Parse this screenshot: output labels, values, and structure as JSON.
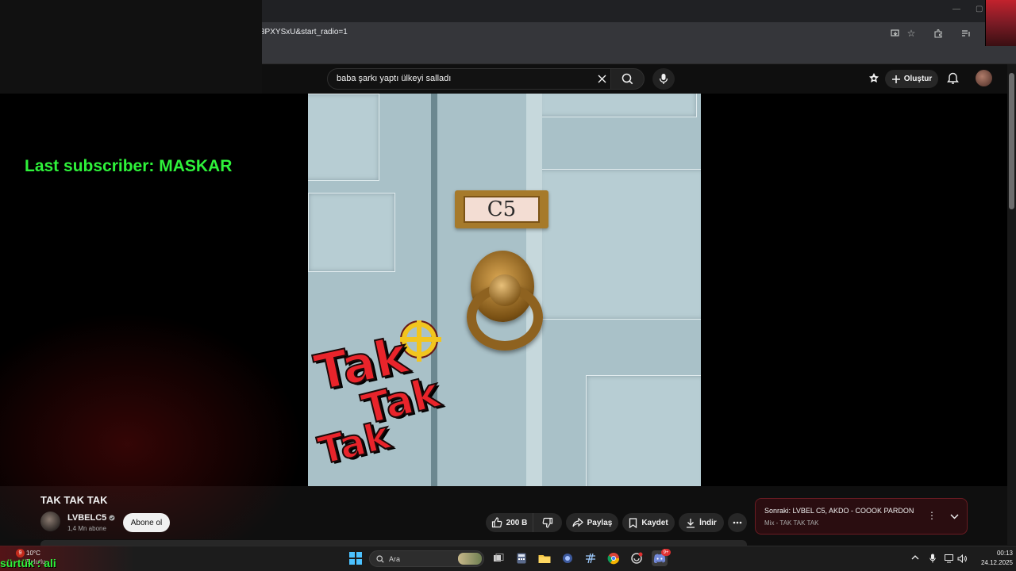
{
  "browser": {
    "url_fragment": "8PXYSxU&start_radio=1",
    "window_controls": [
      "—",
      "▢"
    ]
  },
  "overlay": {
    "last_subscriber": "Last subscriber: MASKAR",
    "bottom_text": "sürtük : ali"
  },
  "masthead": {
    "search_value": "baba şarkı yaptı ülkeyi salladı",
    "create_label": "Oluştur",
    "icons": [
      "clear-icon",
      "search-icon",
      "mic-icon",
      "gem-icon",
      "plus-icon",
      "bell-icon"
    ]
  },
  "video": {
    "plate_text": "C5",
    "sticker_words": [
      "Tak",
      "Tak",
      "Tak"
    ]
  },
  "below_player": {
    "title": "TAK TAK TAK",
    "channel": "LVBELC5",
    "subscribers": "1,4 Mn abone",
    "subscribe_label": "Abone ol",
    "likes": "200 B",
    "share_label": "Paylaş",
    "save_label": "Kaydet",
    "download_label": "İndir"
  },
  "up_next": {
    "title": "Sonraki: LVBEL C5, AKDO - COOOK PARDON",
    "subtitle": "Mix - TAK TAK TAK"
  },
  "taskbar": {
    "weather_temp": "10°C",
    "weather_sub": "Bulutlu",
    "weather_badge": "9",
    "search_placeholder": "Ara",
    "discord_badge": "9+",
    "time": "00:13",
    "date": "24.12.2025"
  },
  "colors": {
    "overlay_green": "#2ef23a",
    "youtube_bg": "#0f0f0f",
    "up_next_bg": "#2a0d10"
  }
}
